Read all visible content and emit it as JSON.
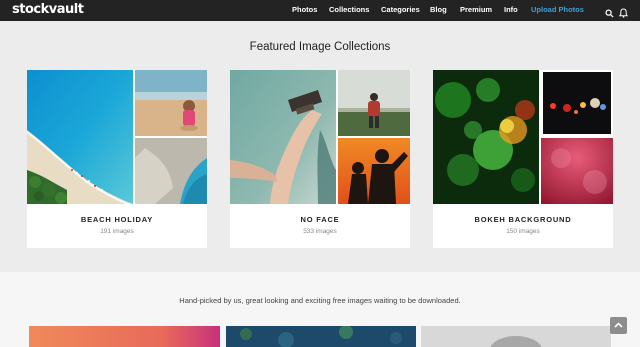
{
  "brand": {
    "logo": "stockvault"
  },
  "nav": {
    "items": [
      "Photos",
      "Collections",
      "Categories",
      "Blog",
      "Premium",
      "Info"
    ],
    "upload": "Upload Photos",
    "icons": [
      "search-icon",
      "bell-icon"
    ]
  },
  "featured": {
    "title": "Featured Image Collections",
    "cards": [
      {
        "title": "BEACH HOLIDAY",
        "count": "191 images"
      },
      {
        "title": "NO FACE",
        "count": "533 images"
      },
      {
        "title": "BOKEH BACKGROUND",
        "count": "150 images"
      }
    ]
  },
  "tagline": "Hand-picked by us, great looking and exciting free images waiting to be downloaded.",
  "colors": {
    "nav_bg": "#232323",
    "accent": "#3aa0d8",
    "page_bg": "#ececec"
  }
}
